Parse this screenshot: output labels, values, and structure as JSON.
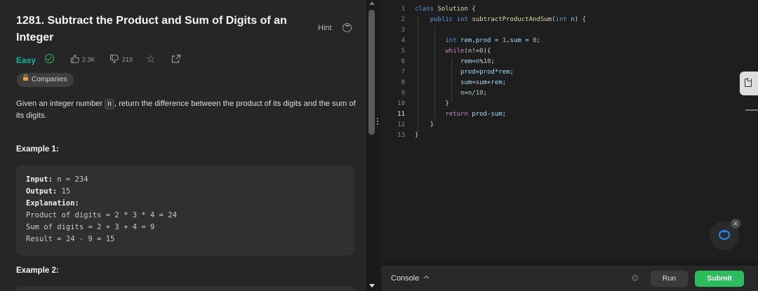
{
  "problem": {
    "title": "1281. Subtract the Product and Sum of Digits of an Integer",
    "hint_label": "Hint",
    "difficulty": "Easy",
    "likes": "2.3K",
    "dislikes": "219",
    "companies_label": "Companies",
    "description_before": "Given an integer number ",
    "description_code": "n",
    "description_after": ", return the difference between the product of its digits and the sum of its digits.",
    "example1_heading": "Example 1:",
    "example1": {
      "input_label": "Input:",
      "input_value": " n = 234",
      "output_label": "Output:",
      "output_value": " 15",
      "explanation_label": "Explanation:",
      "lines": [
        "Product of digits = 2 * 3 * 4 = 24",
        "Sum of digits = 2 + 3 + 4 = 9",
        "Result = 24 - 9 = 15"
      ]
    },
    "example2_heading": "Example 2:"
  },
  "editor": {
    "line_numbers": [
      "1",
      "2",
      "3",
      "4",
      "5",
      "6",
      "7",
      "8",
      "9",
      "10",
      "11",
      "12",
      "13"
    ],
    "active_line": "11"
  },
  "bottom": {
    "console_label": "Console",
    "run_label": "Run",
    "submit_label": "Submit"
  },
  "icons": [
    "more-icon",
    "solved-icon",
    "like-icon",
    "dislike-icon",
    "star-icon",
    "share-icon",
    "lock-icon",
    "document-icon",
    "chat-icon",
    "close-icon",
    "chevron-up-icon",
    "debug-icon"
  ],
  "colors": {
    "easy": "#00b8a3",
    "submit": "#2cbb5d",
    "keyword": "#569cd6",
    "function": "#dcdcaa"
  }
}
